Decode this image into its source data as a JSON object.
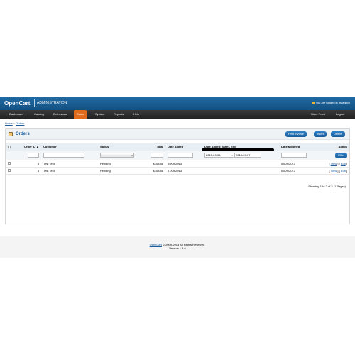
{
  "header": {
    "logo": "OpenCart",
    "subtitle": "ADMINISTRATION",
    "logged_in": "You are logged in as admin"
  },
  "nav": {
    "items": [
      "Dashboard",
      "Catalog",
      "Extensions",
      "Sales",
      "System",
      "Reports",
      "Help"
    ],
    "active": "Sales",
    "store_front": "Store Front",
    "logout": "Logout"
  },
  "breadcrumb": {
    "home": "Home",
    "sep": " :: ",
    "orders": "Orders"
  },
  "page": {
    "title": "Orders",
    "buttons": {
      "print": "Print Invoice",
      "insert": "Insert",
      "delete": "Delete"
    }
  },
  "table": {
    "columns": {
      "order_id": "Order ID",
      "customer": "Customer",
      "status": "Status",
      "total": "Total",
      "date_added": "Date Added",
      "date_range": "Date Added: Start - End",
      "date_modified": "Date Modified",
      "action": "Action"
    },
    "filters": {
      "start_date": "2013-09-06",
      "end_date": "2013-09-07",
      "filter_button": "Filter"
    },
    "rows": [
      {
        "order_id": "4",
        "customer": "Test Test",
        "status": "Pending",
        "total": "$103.88",
        "date_added": "09/09/2013",
        "date_modified": "09/09/2013",
        "view": "View",
        "edit": "Edit"
      },
      {
        "order_id": "3",
        "customer": "Test Test",
        "status": "Pending",
        "total": "$103.88",
        "date_added": "07/09/2013",
        "date_modified": "09/09/2013",
        "view": "View",
        "edit": "Edit"
      }
    ],
    "pagination": "Showing 1 to 2 of 2 (1 Pages)"
  },
  "footer": {
    "link": "OpenCart",
    "copyright": " © 2009-2013 All Rights Reserved.",
    "version": "Version 1.5.6"
  },
  "colors": {
    "header": "#1f6aa5",
    "nav": "#2e2e2e",
    "active_tab": "#e06b1d",
    "button": "#1a5c99"
  }
}
